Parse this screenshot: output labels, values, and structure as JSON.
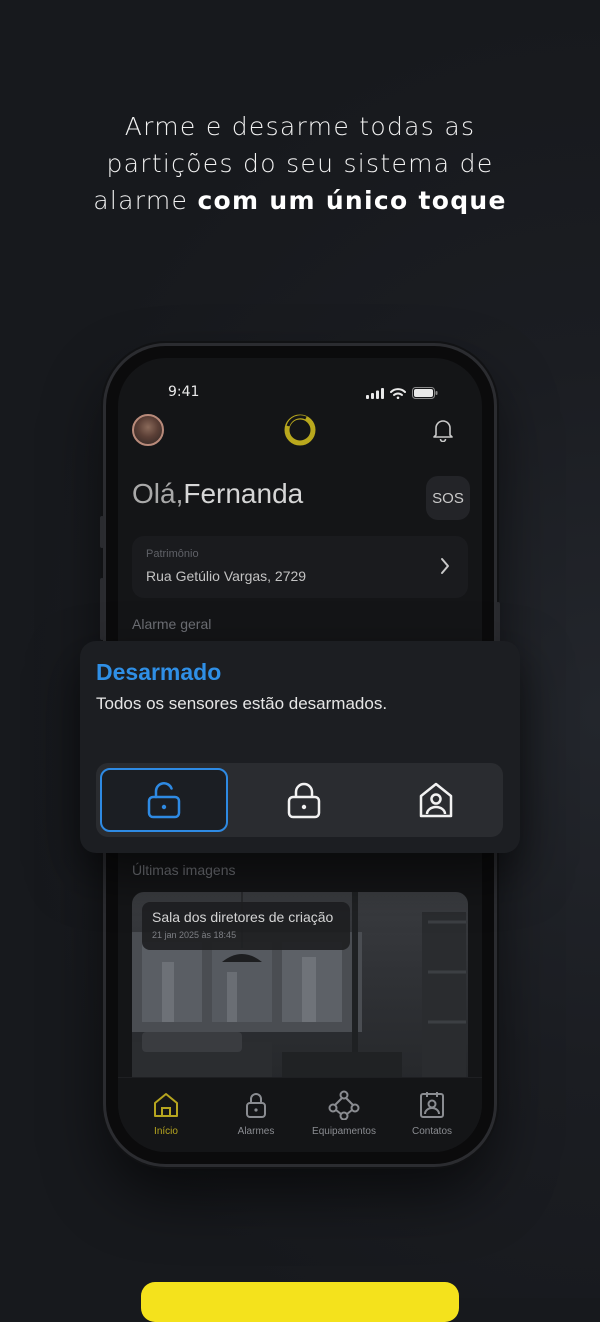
{
  "headline": {
    "line1": "Arme e desarme todas as",
    "line2": "partições do seu sistema de",
    "line3_normal": "alarme ",
    "line3_bold": "com um único toque"
  },
  "status_bar": {
    "time": "9:41"
  },
  "header": {
    "greeting": "Olá,",
    "name": "Fernanda",
    "sos_label": "SOS"
  },
  "patrimonio": {
    "label": "Patrimônio",
    "address": "Rua Getúlio Vargas, 2729"
  },
  "sections": {
    "alarm": "Alarme geral",
    "images": "Últimas imagens"
  },
  "alarm_card": {
    "status": "Desarmado",
    "description": "Todos os sensores estão desarmados.",
    "modes": [
      "unlocked-icon",
      "locked-icon",
      "home-stay-icon"
    ],
    "selected_mode": "unlocked-icon",
    "accent_color": "#2e8ae3"
  },
  "image_card": {
    "title": "Sala dos diretores de criação",
    "date": "21 jan 2025 às 18:45"
  },
  "tabs": [
    {
      "label": "Início",
      "icon": "home-icon",
      "active": true
    },
    {
      "label": "Alarmes",
      "icon": "lock-icon",
      "active": false
    },
    {
      "label": "Equipamentos",
      "icon": "devices-icon",
      "active": false
    },
    {
      "label": "Contatos",
      "icon": "contacts-icon",
      "active": false
    }
  ],
  "colors": {
    "brand_yellow": "#f4e21c",
    "active_tab": "#b6a51f",
    "status_blue": "#2f8fe6"
  }
}
